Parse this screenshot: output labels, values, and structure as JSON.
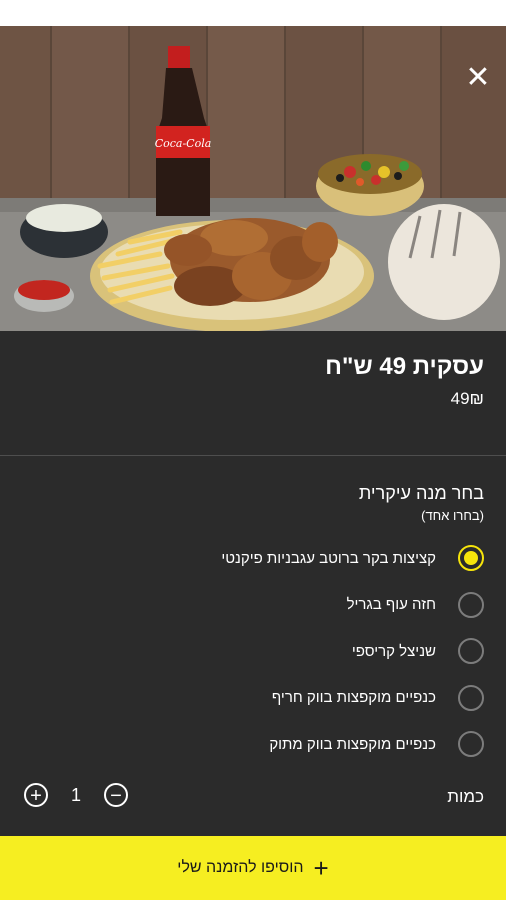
{
  "hero": {
    "image_name": "deal-meal-photo",
    "bottle_text": "Coca-Cola"
  },
  "close_icon": "✕",
  "deal": {
    "title": "עסקית 49 ש\"ח",
    "price": "49₪"
  },
  "group": {
    "title": "בחר מנה עיקרית",
    "hint": "(בחרו אחד)",
    "options": [
      {
        "label": "קציצות בקר ברוטב עגבניות פיקנטי",
        "selected": true
      },
      {
        "label": "חזה עוף בגריל",
        "selected": false
      },
      {
        "label": "שניצל קריספי",
        "selected": false
      },
      {
        "label": "כנפיים מוקפצות בווק חריף",
        "selected": false
      },
      {
        "label": "כנפיים מוקפצות בווק מתוק",
        "selected": false
      }
    ]
  },
  "quantity": {
    "label": "כמות",
    "value": "1",
    "plus": "+",
    "minus": "−"
  },
  "cta": {
    "plus": "+",
    "label": "הוסיפו להזמנה שלי"
  },
  "colors": {
    "accent": "#f6e40b",
    "cta_bg": "#f6ee21",
    "sheet_bg": "#2b2b2b"
  }
}
